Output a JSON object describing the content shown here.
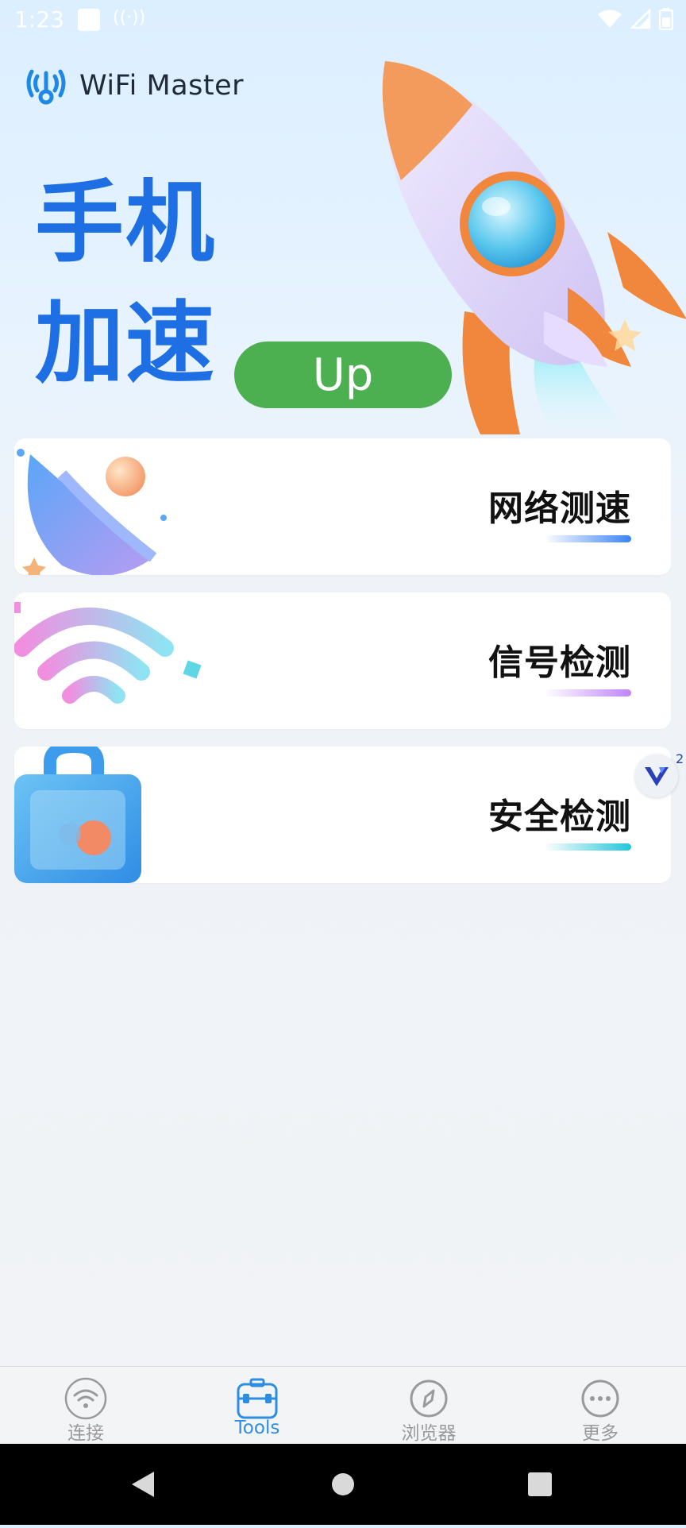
{
  "status_bar": {
    "time": "1:23"
  },
  "app": {
    "name": "WiFi Master"
  },
  "hero": {
    "title": "手机加速",
    "button_label": "Up"
  },
  "cards": [
    {
      "title": "网络测速",
      "accent": "#3b82f6"
    },
    {
      "title": "信号检测",
      "accent": "#c084fc"
    },
    {
      "title": "安全检测",
      "accent": "#22c5d9"
    }
  ],
  "floating_badge": {
    "count": "2"
  },
  "bottom_nav": {
    "items": [
      {
        "label": "连接",
        "icon": "wifi-icon",
        "active": false
      },
      {
        "label": "Tools",
        "icon": "toolbox-icon",
        "active": true
      },
      {
        "label": "浏览器",
        "icon": "compass-icon",
        "active": false
      },
      {
        "label": "更多",
        "icon": "more-dots-icon",
        "active": false
      }
    ]
  },
  "colors": {
    "brand_blue": "#1e6fe3",
    "up_green": "#4caf50",
    "nav_active": "#2d8de0"
  }
}
